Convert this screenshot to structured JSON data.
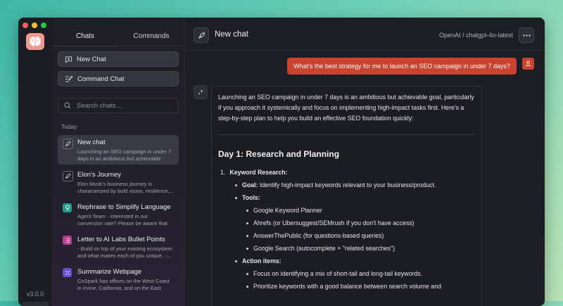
{
  "app": {
    "version": "v3.0.0"
  },
  "colors": {
    "close": "#ff5f57",
    "minimize": "#febc2e",
    "maximize": "#28c840",
    "accent": "#c9432f"
  },
  "sidebar": {
    "tabs": [
      {
        "label": "Chats"
      },
      {
        "label": "Commands"
      }
    ],
    "new_chat_label": "New Chat",
    "command_chat_label": "Command Chat",
    "search_placeholder": "Search chats...",
    "section_label": "Today",
    "chats": [
      {
        "title": "New chat",
        "desc": "Launching an SEO campaign in under 7 days is an ambitious but achievable goa...",
        "icon": "rocket-icon",
        "active": true
      },
      {
        "title": "Elon's Journey",
        "desc": "Elon Musk's business journey is characterized by bold vision, resilience,...",
        "icon": "rocket-icon",
        "active": false
      },
      {
        "title": "Rephrase to Simplify Language",
        "desc": "Agent Team - interested in our conversion rate? Please be aware that it...",
        "icon": "bulb-icon",
        "active": false
      },
      {
        "title": "Letter to AI Labs Bullet Points",
        "desc": "- Build on top of your existing ecosystem and what makes each of you unique. -...",
        "icon": "list-icon",
        "active": false
      },
      {
        "title": "Summarize Webpage",
        "desc": "CoSpark has offices on the West Coast in Irvine, California, and on the East Coast...",
        "icon": "shrink-icon",
        "active": false
      }
    ]
  },
  "header": {
    "title": "New chat",
    "model": "OpenAI / chatgpt-4o-latest"
  },
  "conversation": {
    "user_message": "What's the best strategy for me to launch an SEO campaign in under 7 days?",
    "answer": {
      "intro": "Launching an SEO campaign in under 7 days is an ambitious but achievable goal, particularly if you approach it systemically and focus on implementing high-impact tasks first. Here's a step-by-step plan to help you build an effective SEO foundation quickly:",
      "section_title": "Day 1: Research and Planning",
      "step_title": "Keyword Research:",
      "goal_label": "Goal:",
      "goal_text": "Identify high-impact keywords relevant to your business/product.",
      "tools_label": "Tools:",
      "tools": [
        "Google Keyword Planner",
        "Ahrefs (or Ubersuggest/SEMrush if you don't have access)",
        "AnswerThePublic (for questions-based queries)",
        "Google Search (autocomplete + \"related searches\")"
      ],
      "actions_label": "Action items:",
      "actions": [
        "Focus on identifying a mix of short-tail and long-tail keywords.",
        "Prioritize keywords with a good balance between search volume and"
      ]
    }
  }
}
